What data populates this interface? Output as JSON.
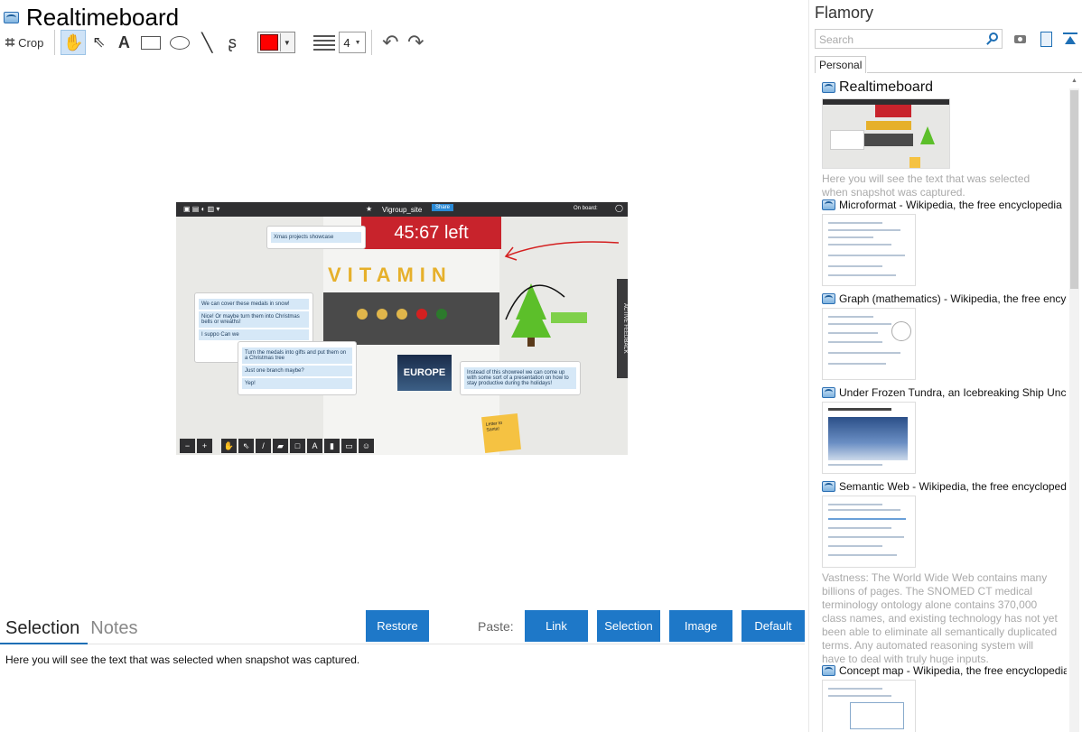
{
  "doc": {
    "title": "Realtimeboard"
  },
  "toolbar": {
    "crop_label": "Crop",
    "line_width": "4"
  },
  "snapshot": {
    "board_name": "Vigroup_site",
    "share": "Share",
    "timer": "45:67 left",
    "on_board": "On board:",
    "bubble_top": "Xmas projects showcase",
    "bubble_left_1": "We can cover these medals in snow!",
    "bubble_left_2": "Nice!",
    "bubble_left_3": "Or maybe turn them into Christmas bells or wreaths!",
    "bubble_left_4": "I suppo",
    "bubble_left_5": "Can we",
    "bubble_mid_1": "Turn the medals into gifts and put them on a Christmas tree",
    "bubble_mid_2": "Just one branch maybe?",
    "bubble_mid_3": "Yep!",
    "bubble_right": "Instead of this showreel we can come up with some sort of a presentation on how to stay productive during the holidays!",
    "photo_text": "EUROPE",
    "letters": "VITAMIN",
    "sticky": "Letter to Santa!",
    "side_active": "ACTIVE",
    "side_feedback": "FEEDBACK",
    "zoom_minus": "−",
    "zoom_plus": "+"
  },
  "bottom": {
    "tab_selection": "Selection",
    "tab_notes": "Notes",
    "restore": "Restore",
    "paste_label": "Paste:",
    "link": "Link",
    "selection": "Selection",
    "image": "Image",
    "default": "Default",
    "selected_text": "Here you will see the text that was selected when snapshot was captured."
  },
  "flamory": {
    "title": "Flamory",
    "search_placeholder": "Search",
    "tab_personal": "Personal",
    "entries": [
      {
        "title": "Realtimeboard",
        "desc": "Here you will see the text that was selected when snapshot was captured."
      },
      {
        "title": "Microformat - Wikipedia, the free encyclopedia"
      },
      {
        "title": "Graph (mathematics) - Wikipedia, the free encyclopedia"
      },
      {
        "title": "Under Frozen Tundra, an Icebreaking Ship Uncovers"
      },
      {
        "title": "Semantic Web - Wikipedia, the free encyclopedia",
        "desc": "Vastness: The World Wide Web contains many billions of pages. The SNOMED CT medical terminology ontology alone contains 370,000 class names, and existing technology has not yet been able to eliminate all semantically duplicated terms. Any automated reasoning system will have to deal with truly huge inputs."
      },
      {
        "title": "Concept map - Wikipedia, the free encyclopedia"
      }
    ]
  }
}
